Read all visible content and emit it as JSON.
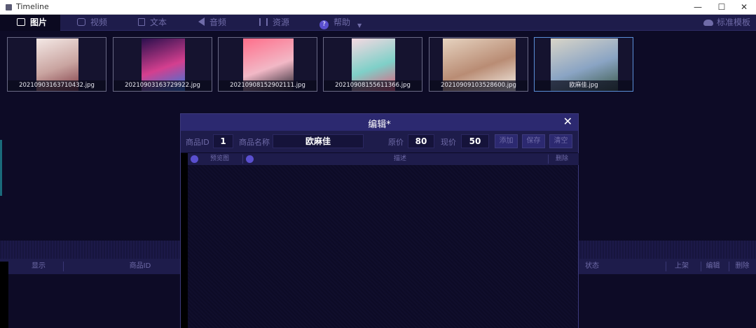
{
  "window": {
    "title": "Timeline",
    "minimize": "—",
    "maximize": "☐",
    "close": "✕"
  },
  "menu": {
    "tabs": [
      {
        "label": "图片",
        "icon": "picture-icon"
      },
      {
        "label": "视频",
        "icon": "video-icon"
      },
      {
        "label": "文本",
        "icon": "document-icon"
      },
      {
        "label": "音频",
        "icon": "audio-icon"
      },
      {
        "label": "资源",
        "icon": "resource-icon"
      },
      {
        "label": "帮助",
        "icon": "help-icon"
      }
    ],
    "right_label": "标准模板"
  },
  "gallery": {
    "items": [
      {
        "name": "20210903163710432.jpg",
        "colors": [
          "#f4e9e6",
          "#c9a4a0",
          "#7e3a44"
        ]
      },
      {
        "name": "20210903163729922.jpg",
        "colors": [
          "#2a0f4d",
          "#d43f8f",
          "#2a7de0"
        ]
      },
      {
        "name": "20210908152902111.jpg",
        "colors": [
          "#ff6e8a",
          "#f2b8c6",
          "#1e1e2a"
        ]
      },
      {
        "name": "20210908155611366.jpg",
        "colors": [
          "#f5d9e2",
          "#7fd0c8",
          "#e85a7a"
        ]
      },
      {
        "name": "20210909103528600.jpg",
        "colors": [
          "#e6d3c0",
          "#b98c74",
          "#f5f1ea"
        ]
      },
      {
        "name": "欧麻佳.jpg",
        "colors": [
          "#d9d5c8",
          "#8aa4c4",
          "#3c5a4a"
        ]
      }
    ],
    "selected_index": 5
  },
  "dialog": {
    "title": "编辑*",
    "close": "✕",
    "fields": {
      "id_label": "商品ID",
      "id_value": "1",
      "name_label": "商品名称",
      "name_value": "欧麻佳",
      "orig_price_label": "原价",
      "orig_price_value": "80",
      "price_label": "现价",
      "price_value": "50"
    },
    "buttons": {
      "add": "添加",
      "save": "保存",
      "clear": "清空"
    },
    "grid_headers": {
      "preview": "预览图",
      "desc": "描述",
      "delete": "删除"
    }
  },
  "bottom": {
    "headers": {
      "h1": "显示",
      "h2": "商品ID",
      "h3": "状态",
      "h4": "上架",
      "h5": "编辑",
      "h6": "删除"
    }
  }
}
